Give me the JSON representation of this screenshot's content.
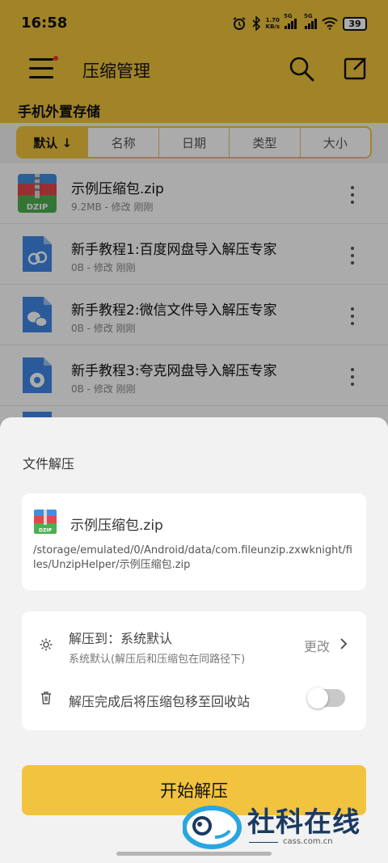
{
  "status_bar": {
    "time": "16:58",
    "net_speed_value": "1.70",
    "net_speed_unit": "KB/s",
    "sim1_label": "5G",
    "sim2_label": "5G",
    "battery": "39",
    "icons": [
      "alarm-icon",
      "bluetooth-icon",
      "signal-icon",
      "wifi-icon",
      "battery-icon"
    ]
  },
  "app_bar": {
    "title": "压缩管理",
    "icons": [
      "menu-icon",
      "search-icon",
      "edit-icon"
    ]
  },
  "storage_label": "手机外置存储",
  "sort_tabs": [
    {
      "label": "默认 ↓",
      "active": true
    },
    {
      "label": "名称",
      "active": false
    },
    {
      "label": "日期",
      "active": false
    },
    {
      "label": "类型",
      "active": false
    },
    {
      "label": "大小",
      "active": false
    }
  ],
  "files": [
    {
      "name": "示例压缩包.zip",
      "meta": "9.2MB - 修改 刚刚",
      "icon": "zip-file-icon",
      "icon_text": "DZIP"
    },
    {
      "name": "新手教程1:百度网盘导入解压专家",
      "meta": "0B - 修改 刚刚",
      "icon": "baidu-file-icon"
    },
    {
      "name": "新手教程2:微信文件导入解压专家",
      "meta": "0B - 修改 刚刚",
      "icon": "wechat-file-icon"
    },
    {
      "name": "新手教程3:夸克网盘导入解压专家",
      "meta": "0B - 修改 刚刚",
      "icon": "quark-file-icon"
    }
  ],
  "sheet": {
    "title": "文件解压",
    "file_name": "示例压缩包.zip",
    "file_icon_text": "DZIP",
    "file_path": "/storage/emulated/0/Android/data/com.fileunzip.zxwknight/files/UnzipHelper/示例压缩包.zip",
    "extract_to_label": "解压到：系统默认",
    "extract_to_sub": "系统默认(解压后和压缩包在同路径下)",
    "change_label": "更改",
    "recycle_label": "解压完成后将压缩包移至回收站",
    "recycle_toggle_on": false,
    "start_button": "开始解压"
  },
  "watermark": {
    "text": "社科在线",
    "url": "cass.com.cn"
  },
  "colors": {
    "accent": "#f1c33d",
    "sheet_bg": "#f2f2f2",
    "watermark_blue": "#1a3a63"
  }
}
